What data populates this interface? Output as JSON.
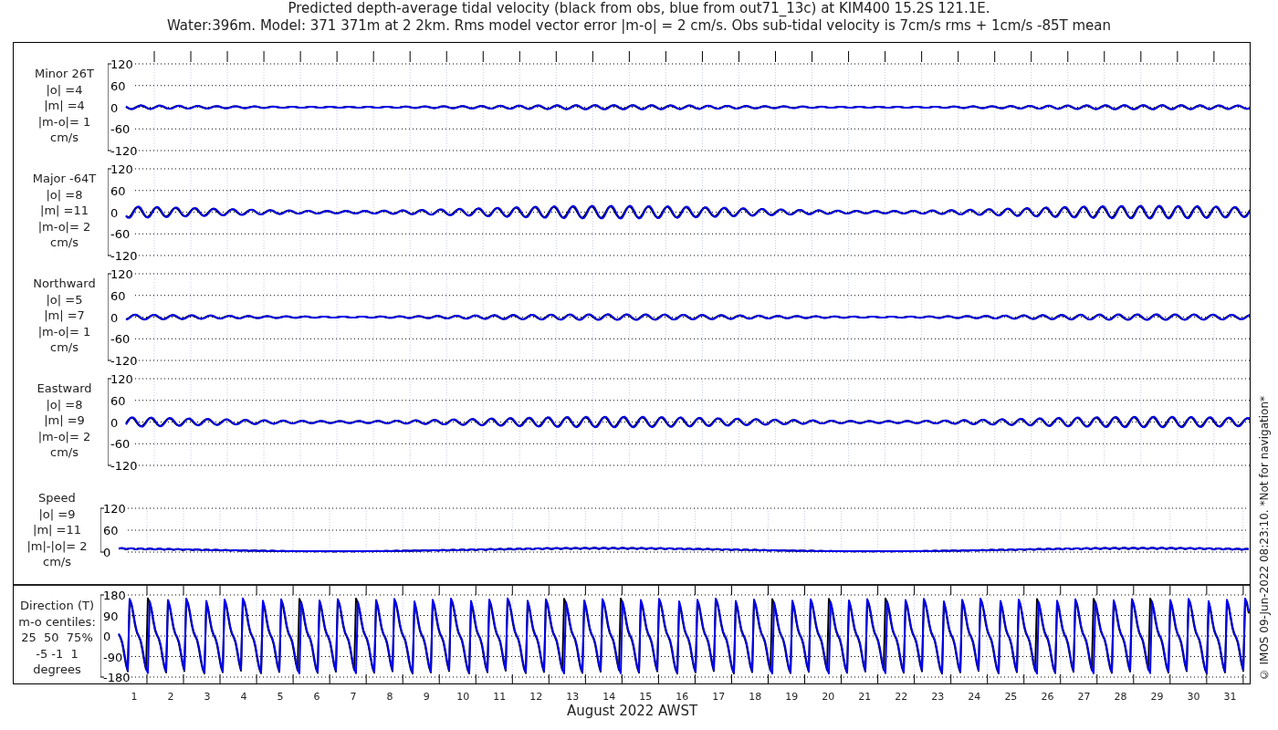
{
  "title": {
    "lines": [
      "Predicted depth-average tidal velocity (black from obs, blue from out71_13c) at KIM400 15.2S 121.1E.",
      "Water:396m. Model: 371 371m at 2 2km. Rms model vector error |m-o| = 2 cm/s. Obs sub-tidal velocity is 7cm/s rms + 1cm/s -85T mean"
    ]
  },
  "panels": [
    {
      "kind": "velocity",
      "label_lines": [
        "Minor 26T",
        "|o| =4",
        "|m| =4",
        "|m-o|= 1",
        "cm/s"
      ],
      "yticks": [
        "120",
        "60",
        "0",
        "-60",
        "-120"
      ]
    },
    {
      "kind": "velocity",
      "label_lines": [
        "Major -64T",
        "|o| =8",
        "|m| =11",
        "|m-o|= 2",
        "cm/s"
      ],
      "yticks": [
        "120",
        "60",
        "0",
        "-60",
        "-120"
      ]
    },
    {
      "kind": "velocity",
      "label_lines": [
        "Northward",
        "|o| =5",
        "|m| =7",
        "|m-o|= 1",
        "cm/s"
      ],
      "yticks": [
        "120",
        "60",
        "0",
        "-60",
        "-120"
      ]
    },
    {
      "kind": "velocity",
      "label_lines": [
        "Eastward",
        "|o| =8",
        "|m| =9",
        "|m-o|= 2",
        "cm/s"
      ],
      "yticks": [
        "120",
        "60",
        "0",
        "-60",
        "-120"
      ]
    },
    {
      "kind": "speed",
      "label_lines": [
        "Speed",
        "|o| =9",
        "|m| =11",
        "|m|-|o|= 2",
        "cm/s"
      ],
      "yticks": [
        "120",
        "60",
        "0"
      ]
    },
    {
      "kind": "direction",
      "label_lines": [
        "Direction (T)",
        "m-o centiles:",
        "25  50  75%",
        "-5 -1  1",
        "degrees"
      ],
      "yticks": [
        "180",
        "90",
        "0",
        "-90",
        "-180"
      ]
    }
  ],
  "x_axis": {
    "ticks": [
      "1",
      "2",
      "3",
      "4",
      "5",
      "6",
      "7",
      "8",
      "9",
      "10",
      "11",
      "12",
      "13",
      "14",
      "15",
      "16",
      "17",
      "18",
      "19",
      "20",
      "21",
      "22",
      "23",
      "24",
      "25",
      "26",
      "27",
      "28",
      "29",
      "30",
      "31"
    ],
    "label": "August 2022 AWST"
  },
  "side_note": "© IMOS 09-Jun-2022 08:23:10.  *Not for navigation*"
}
